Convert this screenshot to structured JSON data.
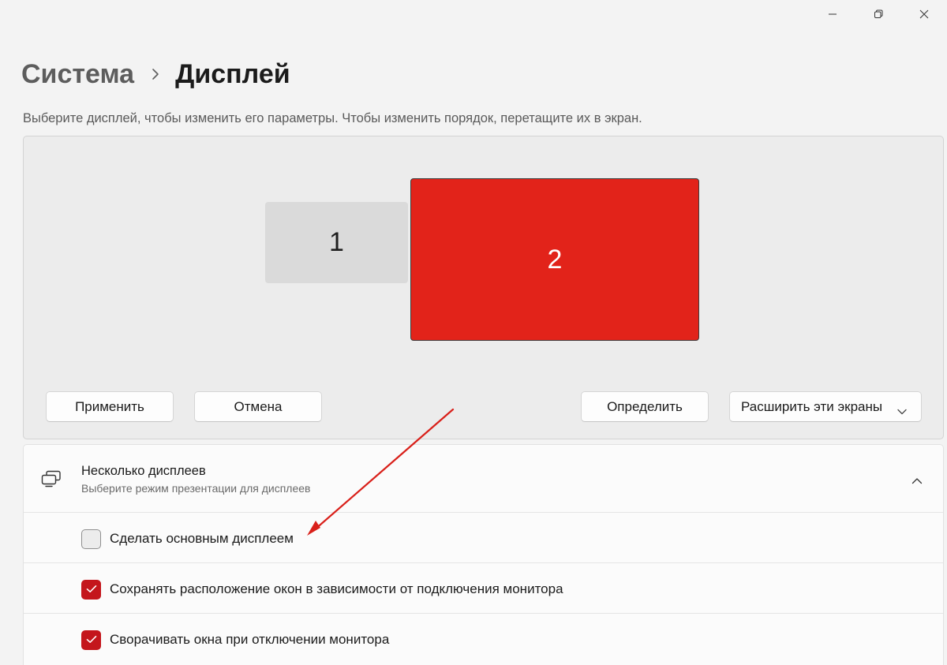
{
  "window": {
    "controls": [
      "minimize-icon",
      "restore-icon",
      "close-icon"
    ]
  },
  "breadcrumb": {
    "parent": "Система",
    "current": "Дисплей"
  },
  "hint": "Выберите дисплей, чтобы изменить его параметры. Чтобы изменить порядок, перетащите их в экран.",
  "arrangement": {
    "monitors": [
      {
        "label": "1",
        "color": "#dadada"
      },
      {
        "label": "2",
        "color": "#e2231a"
      }
    ],
    "buttons": {
      "apply": "Применить",
      "cancel": "Отмена",
      "identify": "Определить"
    },
    "mode_select": {
      "value": "Расширить эти экраны"
    }
  },
  "multiple_displays": {
    "title": "Несколько дисплеев",
    "subtitle": "Выберите режим презентации для дисплеев",
    "icon": "monitors-icon",
    "options": [
      {
        "label": "Сделать основным дисплеем",
        "checked": false
      },
      {
        "label": "Сохранять расположение окон в зависимости от подключения монитора",
        "checked": true
      },
      {
        "label": "Сворачивать окна при отключении монитора",
        "checked": true
      }
    ]
  },
  "colors": {
    "accent": "#c4161c",
    "annotation_arrow": "#d9201a"
  }
}
